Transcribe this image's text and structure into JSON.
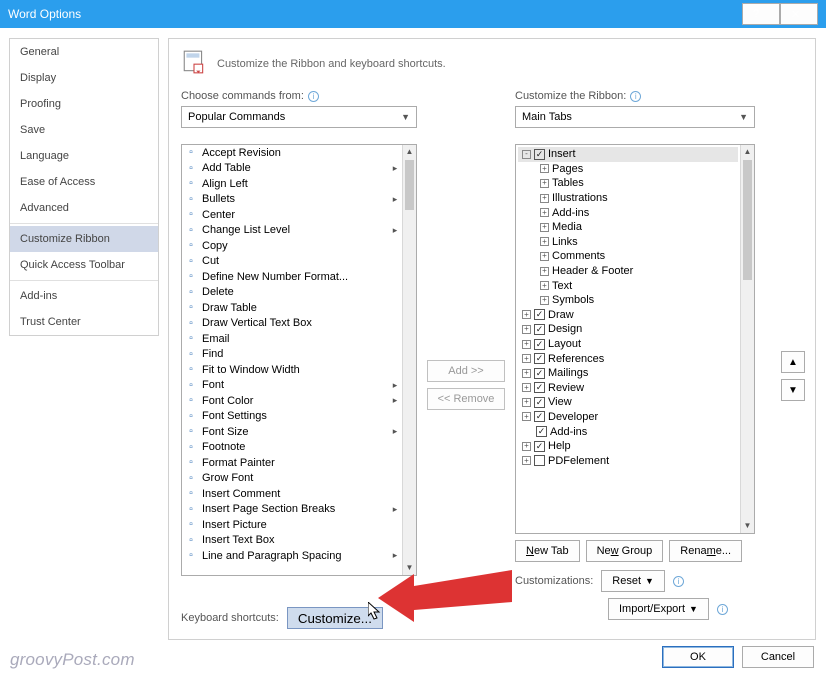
{
  "titlebar": {
    "title": "Word Options"
  },
  "sidebar": {
    "items": [
      "General",
      "Display",
      "Proofing",
      "Save",
      "Language",
      "Ease of Access",
      "Advanced",
      "Customize Ribbon",
      "Quick Access Toolbar",
      "Add-ins",
      "Trust Center"
    ],
    "selected_index": 7,
    "separators_after": [
      6,
      8
    ]
  },
  "header": {
    "text": "Customize the Ribbon and keyboard shortcuts."
  },
  "left": {
    "label": "Choose commands from:",
    "dropdown": "Popular Commands",
    "items": [
      {
        "t": "Accept Revision",
        "sub": false
      },
      {
        "t": "Add Table",
        "sub": true
      },
      {
        "t": "Align Left",
        "sub": false
      },
      {
        "t": "Bullets",
        "sub": true
      },
      {
        "t": "Center",
        "sub": false
      },
      {
        "t": "Change List Level",
        "sub": true
      },
      {
        "t": "Copy",
        "sub": false
      },
      {
        "t": "Cut",
        "sub": false
      },
      {
        "t": "Define New Number Format...",
        "sub": false
      },
      {
        "t": "Delete",
        "sub": false
      },
      {
        "t": "Draw Table",
        "sub": false
      },
      {
        "t": "Draw Vertical Text Box",
        "sub": false
      },
      {
        "t": "Email",
        "sub": false
      },
      {
        "t": "Find",
        "sub": false
      },
      {
        "t": "Fit to Window Width",
        "sub": false
      },
      {
        "t": "Font",
        "sub": true
      },
      {
        "t": "Font Color",
        "sub": true
      },
      {
        "t": "Font Settings",
        "sub": false
      },
      {
        "t": "Font Size",
        "sub": true
      },
      {
        "t": "Footnote",
        "sub": false
      },
      {
        "t": "Format Painter",
        "sub": false
      },
      {
        "t": "Grow Font",
        "sub": false
      },
      {
        "t": "Insert Comment",
        "sub": false
      },
      {
        "t": "Insert Page  Section Breaks",
        "sub": true
      },
      {
        "t": "Insert Picture",
        "sub": false
      },
      {
        "t": "Insert Text Box",
        "sub": false
      },
      {
        "t": "Line and Paragraph Spacing",
        "sub": true
      }
    ]
  },
  "mid": {
    "add": "Add >>",
    "remove": "<< Remove"
  },
  "right": {
    "label": "Customize the Ribbon:",
    "dropdown": "Main Tabs",
    "tree": [
      {
        "indent": 0,
        "exp": "-",
        "chk": true,
        "t": "Insert",
        "hl": true
      },
      {
        "indent": 1,
        "exp": "+",
        "chk": null,
        "t": "Pages"
      },
      {
        "indent": 1,
        "exp": "+",
        "chk": null,
        "t": "Tables"
      },
      {
        "indent": 1,
        "exp": "+",
        "chk": null,
        "t": "Illustrations"
      },
      {
        "indent": 1,
        "exp": "+",
        "chk": null,
        "t": "Add-ins"
      },
      {
        "indent": 1,
        "exp": "+",
        "chk": null,
        "t": "Media"
      },
      {
        "indent": 1,
        "exp": "+",
        "chk": null,
        "t": "Links"
      },
      {
        "indent": 1,
        "exp": "+",
        "chk": null,
        "t": "Comments"
      },
      {
        "indent": 1,
        "exp": "+",
        "chk": null,
        "t": "Header & Footer"
      },
      {
        "indent": 1,
        "exp": "+",
        "chk": null,
        "t": "Text"
      },
      {
        "indent": 1,
        "exp": "+",
        "chk": null,
        "t": "Symbols"
      },
      {
        "indent": 0,
        "exp": "+",
        "chk": true,
        "t": "Draw"
      },
      {
        "indent": 0,
        "exp": "+",
        "chk": true,
        "t": "Design"
      },
      {
        "indent": 0,
        "exp": "+",
        "chk": true,
        "t": "Layout"
      },
      {
        "indent": 0,
        "exp": "+",
        "chk": true,
        "t": "References"
      },
      {
        "indent": 0,
        "exp": "+",
        "chk": true,
        "t": "Mailings"
      },
      {
        "indent": 0,
        "exp": "+",
        "chk": true,
        "t": "Review"
      },
      {
        "indent": 0,
        "exp": "+",
        "chk": true,
        "t": "View"
      },
      {
        "indent": 0,
        "exp": "+",
        "chk": true,
        "t": "Developer"
      },
      {
        "indent": 0,
        "exp": "",
        "chk": true,
        "t": "Add-ins"
      },
      {
        "indent": 0,
        "exp": "+",
        "chk": true,
        "t": "Help"
      },
      {
        "indent": 0,
        "exp": "+",
        "chk": false,
        "t": "PDFelement"
      }
    ],
    "newtab": "New Tab",
    "newgroup": "New Group",
    "rename": "Rename...",
    "customizations": "Customizations:",
    "reset": "Reset",
    "importexport": "Import/Export"
  },
  "kbd": {
    "label": "Keyboard shortcuts:",
    "btn": "Customize..."
  },
  "footer": {
    "ok": "OK",
    "cancel": "Cancel"
  },
  "watermark": "groovyPost.com"
}
